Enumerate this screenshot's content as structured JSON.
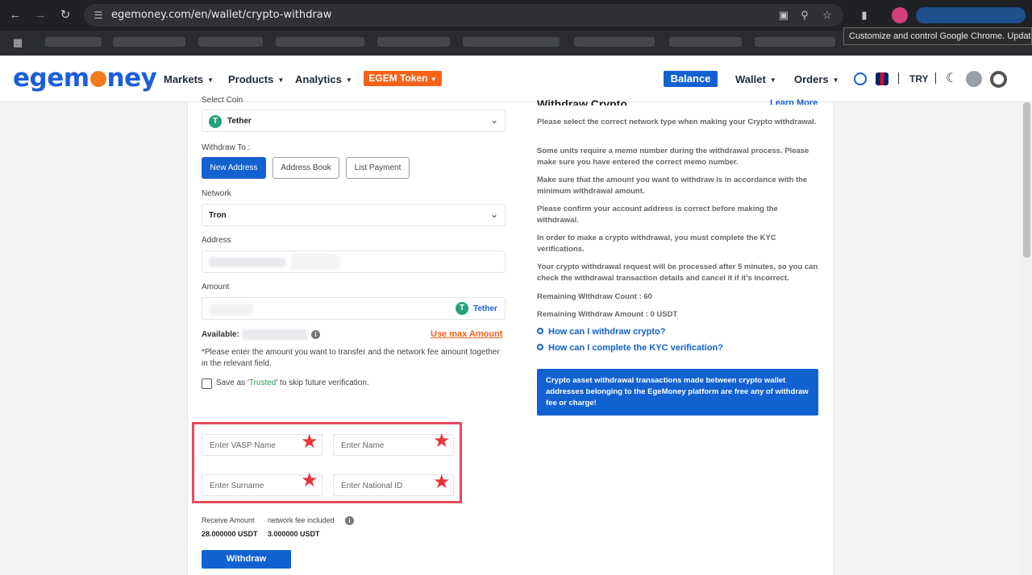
{
  "browser": {
    "url": "egemoney.com/en/wallet/crypto-withdraw",
    "tooltip": "Customize and control Google Chrome. Update is"
  },
  "header": {
    "logo_parts": [
      "eg",
      "em",
      "ney"
    ],
    "menu": [
      "Markets",
      "Products",
      "Analytics"
    ],
    "token_button": "EGEM Token",
    "balance": "Balance",
    "wallet": "Wallet",
    "orders": "Orders",
    "currency": "TRY",
    "separator": "|"
  },
  "form": {
    "select_coin_label": "Select Coin",
    "coin": "Tether",
    "withdraw_to_label": "Withdraw To :",
    "tabs": [
      "New Address",
      "Address Book",
      "List Payment"
    ],
    "network_label": "Network",
    "network": "Tron",
    "address_label": "Address",
    "amount_label": "Amount",
    "amount_unit": "Tether",
    "available_label": "Available:",
    "max_amount": "Use max Amount",
    "note": "*Please enter the amount you want to transfer and the network fee amount together in the relevant field.",
    "save_prefix": "Save as '",
    "save_trusted": "Trusted",
    "save_suffix": "' to skip future verification.",
    "vasp_placeholder": "Enter VASP Name",
    "name_placeholder": "Enter Name",
    "surname_placeholder": "Enter Surname",
    "national_id_placeholder": "Enter National ID",
    "receive_label": "Receive Amount",
    "fee_label": "network fee included",
    "receive_value": "28.000000 USDT",
    "fee_value": "3.000000 USDT",
    "withdraw_button": "Withdraw"
  },
  "info": {
    "title": "Withdraw Crypto",
    "learn_more": "Learn More",
    "paragraphs": [
      "Please select the correct network type when making your Crypto withdrawal.",
      "Some units require a memo number during the withdrawal process. Please make sure you have entered the correct memo number.",
      "Make sure that the amount you want to withdraw is in accordance with the minimum withdrawal amount.",
      "Please confirm your account address is correct before making the withdrawal.",
      "In order to make a crypto withdrawal, you must complete the KYC verifications.",
      "Your crypto withdrawal request will be processed after 5 minutes, so you can check the withdrawal transaction details and cancel it if it's incorrect."
    ],
    "remaining_count": "Remaining Withdraw Count : 60",
    "remaining_amount": "Remaining Withdraw Amount : 0 USDT",
    "faq": [
      "How can I withdraw crypto?",
      "How can I complete the KYC verification?"
    ],
    "box": "Crypto asset withdrawal transactions made between crypto wallet addresses belonging to the EgeMoney platform are free any of withdraw fee or charge!"
  },
  "colors": {
    "brand_blue": "#1261d1",
    "orange": "#f7631a",
    "highlight_red": "#e34a5a",
    "tether_green": "#26a17b"
  }
}
